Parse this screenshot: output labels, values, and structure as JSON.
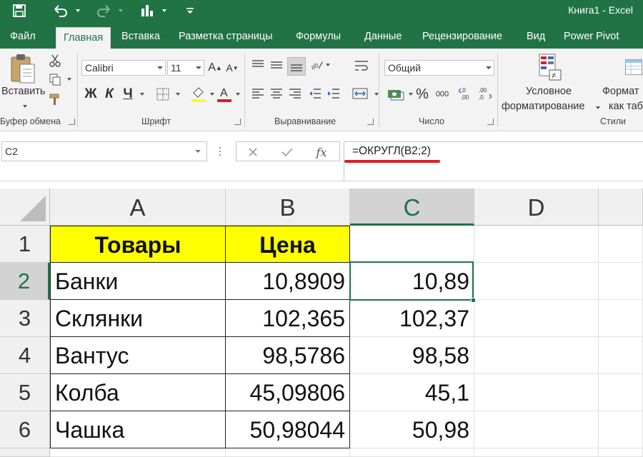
{
  "window": {
    "title": "Книга1 - Excel"
  },
  "quick_access": {
    "icons": [
      "save-icon",
      "undo-icon",
      "redo-icon",
      "chart-icon",
      "customize-icon"
    ]
  },
  "tabs": [
    {
      "label": "Файл"
    },
    {
      "label": "Главная",
      "active": true
    },
    {
      "label": "Вставка"
    },
    {
      "label": "Разметка страницы"
    },
    {
      "label": "Формулы"
    },
    {
      "label": "Данные"
    },
    {
      "label": "Рецензирование"
    },
    {
      "label": "Вид"
    },
    {
      "label": "Power Pivot"
    }
  ],
  "ribbon": {
    "clipboard": {
      "paste_label": "Вставить",
      "group_label": "Буфер обмена"
    },
    "font": {
      "font_name": "Calibri",
      "font_size": "11",
      "bold": "Ж",
      "italic": "К",
      "underline": "Ч",
      "group_label": "Шрифт"
    },
    "alignment": {
      "group_label": "Выравнивание"
    },
    "number": {
      "format": "Общий",
      "percent": "%",
      "thousands": "000",
      "group_label": "Число"
    },
    "styles": {
      "conditional_line1": "Условное",
      "conditional_line2": "форматирование",
      "format_line1": "Формат",
      "format_line2": "как таб",
      "group_label": "Стили"
    }
  },
  "formula_bar": {
    "name_box": "C2",
    "fx": "fx",
    "formula": "=ОКРУГЛ(B2;2)"
  },
  "sheet": {
    "columns": [
      "A",
      "B",
      "C",
      "D"
    ],
    "rows": [
      "1",
      "2",
      "3",
      "4",
      "5",
      "6"
    ],
    "selected_cell": "C2",
    "header_row": {
      "a": "Товары",
      "b": "Цена"
    },
    "data": [
      {
        "a": "Банки",
        "b": "10,8909",
        "c": "10,89"
      },
      {
        "a": "Склянки",
        "b": "102,365",
        "c": "102,37"
      },
      {
        "a": "Вантус",
        "b": "98,5786",
        "c": "98,58"
      },
      {
        "a": "Колба",
        "b": "45,09806",
        "c": "45,1"
      },
      {
        "a": "Чашка",
        "b": "50,98044",
        "c": "50,98"
      }
    ]
  },
  "colors": {
    "excel_green": "#217346",
    "header_fill": "#ffff00",
    "annotation_red": "#d62027"
  }
}
